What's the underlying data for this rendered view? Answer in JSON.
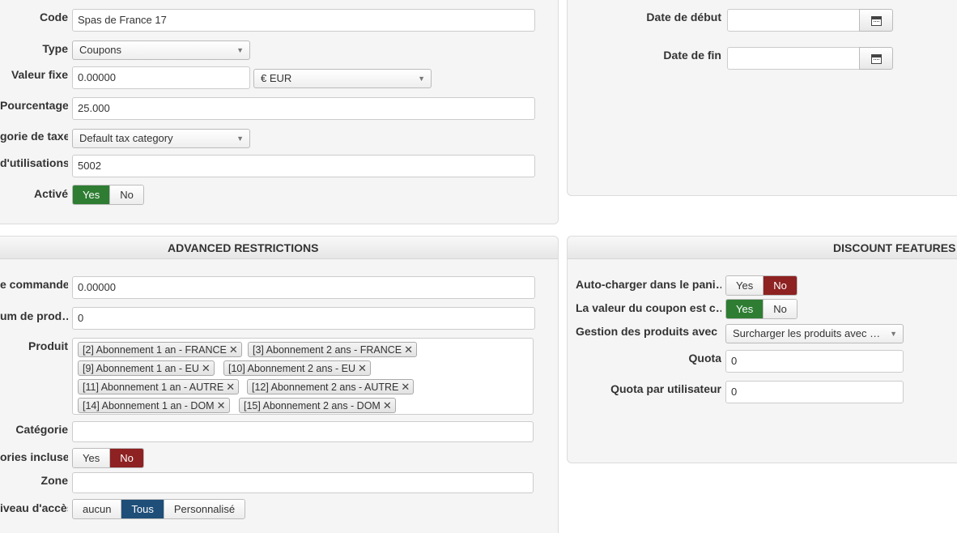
{
  "coupon_form": {
    "code": {
      "label": "Code",
      "value": "Spas de France 17"
    },
    "type": {
      "label": "Type",
      "value": "Coupons"
    },
    "valeur_fixe": {
      "label": "Valeur fixe",
      "value": "0.00000",
      "currency": "€ EUR"
    },
    "pourcentage": {
      "label": "Pourcentage",
      "value": "25.000"
    },
    "tax_category": {
      "label": "gorie de taxe",
      "value": "Default tax category"
    },
    "utilisations": {
      "label": "d'utilisations",
      "value": "5002"
    },
    "active": {
      "label": "Activé",
      "yes": "Yes",
      "no": "No",
      "selected": "Yes"
    }
  },
  "dates": {
    "start": {
      "label": "Date de début",
      "value": ""
    },
    "end": {
      "label": "Date de fin",
      "value": ""
    },
    "calendar_icon": "calendar-icon"
  },
  "advanced_restrictions": {
    "title": "ADVANCED RESTRICTIONS",
    "min_order": {
      "label": "e commande",
      "value": "0.00000"
    },
    "min_products": {
      "label": "um de prod…",
      "value": "0"
    },
    "products": {
      "label": "Produit",
      "tags": [
        "[2] Abonnement 1 an - FRANCE",
        "[3] Abonnement 2 ans - FRANCE",
        "[9] Abonnement 1 an - EU",
        "[10] Abonnement 2 ans - EU",
        "[11] Abonnement 1 an - AUTRE",
        "[12] Abonnement 2 ans - AUTRE",
        "[14] Abonnement 1 an - DOM",
        "[15] Abonnement 2 ans - DOM"
      ],
      "remove_glyph": "✕"
    },
    "category": {
      "label": "Catégorie",
      "value": ""
    },
    "categories_included": {
      "label": "ories incluses",
      "yes": "Yes",
      "no": "No",
      "selected": "No"
    },
    "zone": {
      "label": "Zone",
      "value": ""
    },
    "access_level": {
      "label": "iveau d'accès",
      "options": [
        "aucun",
        "Tous",
        "Personnalisé"
      ],
      "selected": "Tous"
    }
  },
  "discount_features": {
    "title": "DISCOUNT FEATURES",
    "auto_load": {
      "label": "Auto-charger dans le pani…",
      "yes": "Yes",
      "no": "No",
      "selected": "No"
    },
    "coupon_value": {
      "label": "La valeur du coupon est c…",
      "yes": "Yes",
      "no": "No",
      "selected": "Yes"
    },
    "product_handling": {
      "label": "Gestion des produits avec …",
      "value": "Surcharger les produits avec …"
    },
    "quota": {
      "label": "Quota",
      "value": "0"
    },
    "quota_per_user": {
      "label": "Quota par utilisateur",
      "value": "0"
    }
  },
  "colors": {
    "yes_active": "#2e7d32",
    "no_active": "#8e2121",
    "selected_blue": "#1f4e79"
  }
}
